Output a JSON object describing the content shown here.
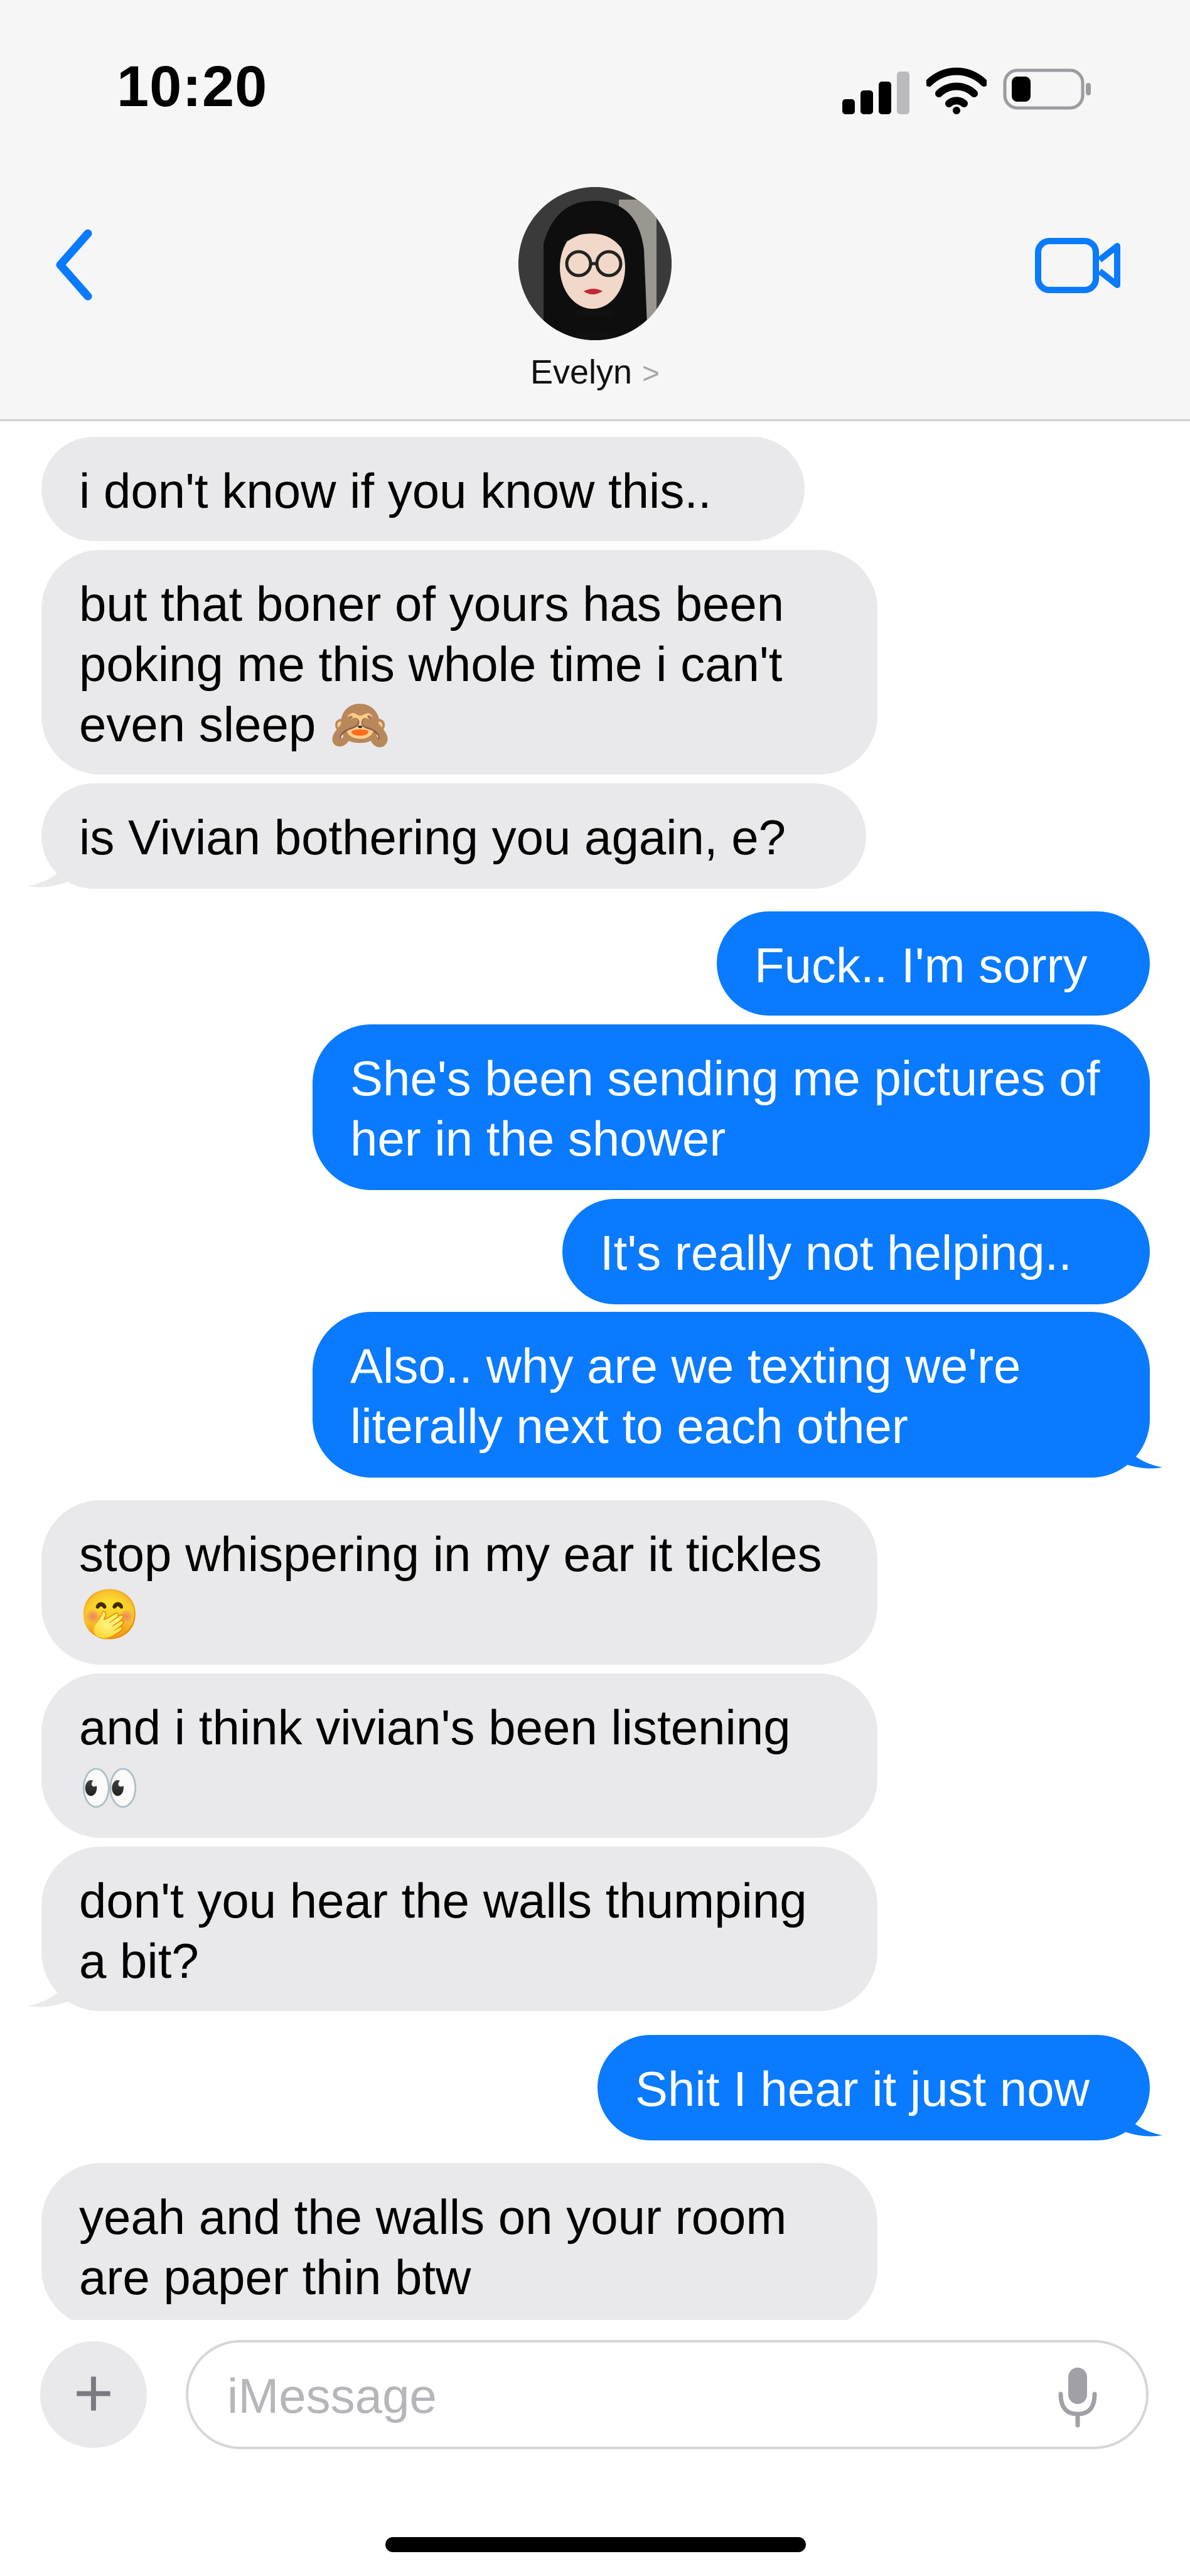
{
  "status_bar": {
    "time": "10:20"
  },
  "header": {
    "contact_name": "Evelyn",
    "chevron": ">",
    "back_icon": "chevron-left-icon",
    "video_icon": "video-camera-icon"
  },
  "messages": [
    {
      "from": "contact",
      "text": "i don't know if you know this.."
    },
    {
      "from": "contact",
      "text": "but that boner of yours has been poking me this whole time i can't even sleep 🙈"
    },
    {
      "from": "contact",
      "text": "is Vivian bothering you again, e?"
    },
    {
      "from": "me",
      "text": "Fuck.. I'm sorry"
    },
    {
      "from": "me",
      "text": "She's been sending me pictures of her in the shower"
    },
    {
      "from": "me",
      "text": "It's really not helping.."
    },
    {
      "from": "me",
      "text": "Also.. why are we texting we're literally next to each other"
    },
    {
      "from": "contact",
      "text": "stop whispering in my ear it tickles 🤭"
    },
    {
      "from": "contact",
      "text": "and i think vivian's been listening 👀"
    },
    {
      "from": "contact",
      "text": "don't you hear the walls thumping a bit?"
    },
    {
      "from": "me",
      "text": "Shit I hear it just now"
    },
    {
      "from": "contact",
      "text": "yeah and the walls on your room are paper thin btw"
    }
  ],
  "composer": {
    "plus_label": "+",
    "placeholder": "iMessage",
    "mic_icon": "microphone-icon"
  },
  "colors": {
    "outgoing_bubble": "#0a7aff",
    "incoming_bubble": "#e9e9eb",
    "accent": "#0a7aff"
  }
}
